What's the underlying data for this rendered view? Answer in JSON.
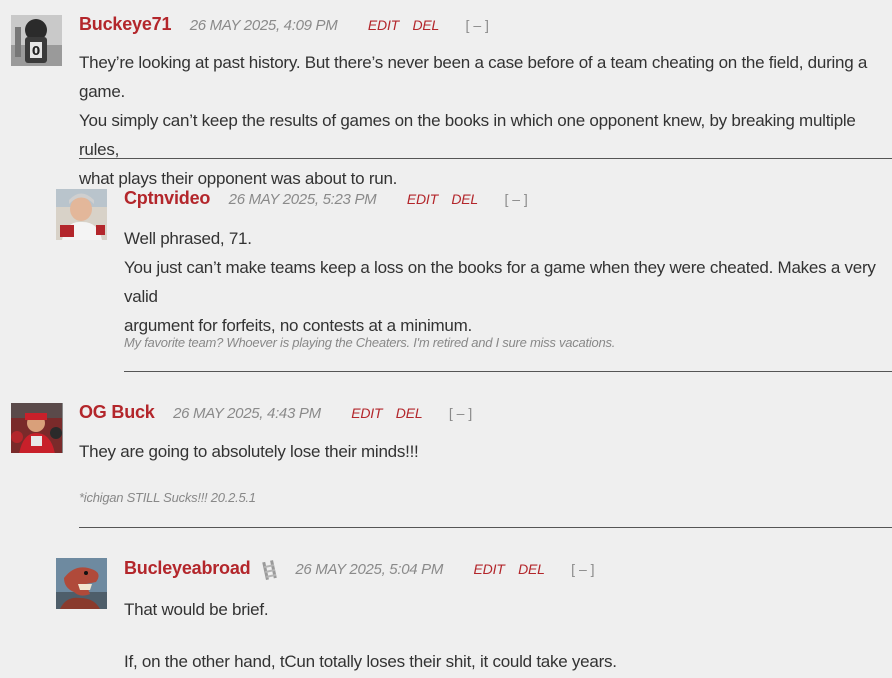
{
  "comments": [
    {
      "username": "Buckeye71",
      "timestamp": "26 MAY 2025, 4:09 PM",
      "edit": "EDIT",
      "del": "DEL",
      "collapse": "[ – ]",
      "body": [
        "They’re looking at past history. But there’s never been a case before of a team cheating on the field, during a game.",
        "You simply can’t keep the results of games on the books in which one opponent knew, by breaking multiple rules,",
        "what plays their opponent was about to run."
      ]
    },
    {
      "username": "Cptnvideo",
      "timestamp": "26 MAY 2025, 5:23 PM",
      "edit": "EDIT",
      "del": "DEL",
      "collapse": "[ – ]",
      "body": [
        "Well phrased, 71.",
        "You just can’t make teams keep a loss on the books for a game when they were cheated. Makes a very valid",
        "argument for forfeits, no contests at a minimum."
      ],
      "signature": "My favorite team? Whoever is playing the Cheaters. I'm retired and I sure miss vacations."
    },
    {
      "username": "OG Buck",
      "timestamp": "26 MAY 2025, 4:43 PM",
      "edit": "EDIT",
      "del": "DEL",
      "collapse": "[ – ]",
      "body": [
        "They are going to absolutely lose their minds!!!"
      ],
      "signature": "*ichigan STILL Sucks!!! 20.2.5.1"
    },
    {
      "username": "Bucleyeabroad",
      "timestamp": "26 MAY 2025, 5:04 PM",
      "edit": "EDIT",
      "del": "DEL",
      "collapse": "[ – ]",
      "body": [
        "That would be brief.",
        "",
        "If, on the other hand, tCun totally loses their shit, it could take years."
      ]
    }
  ]
}
